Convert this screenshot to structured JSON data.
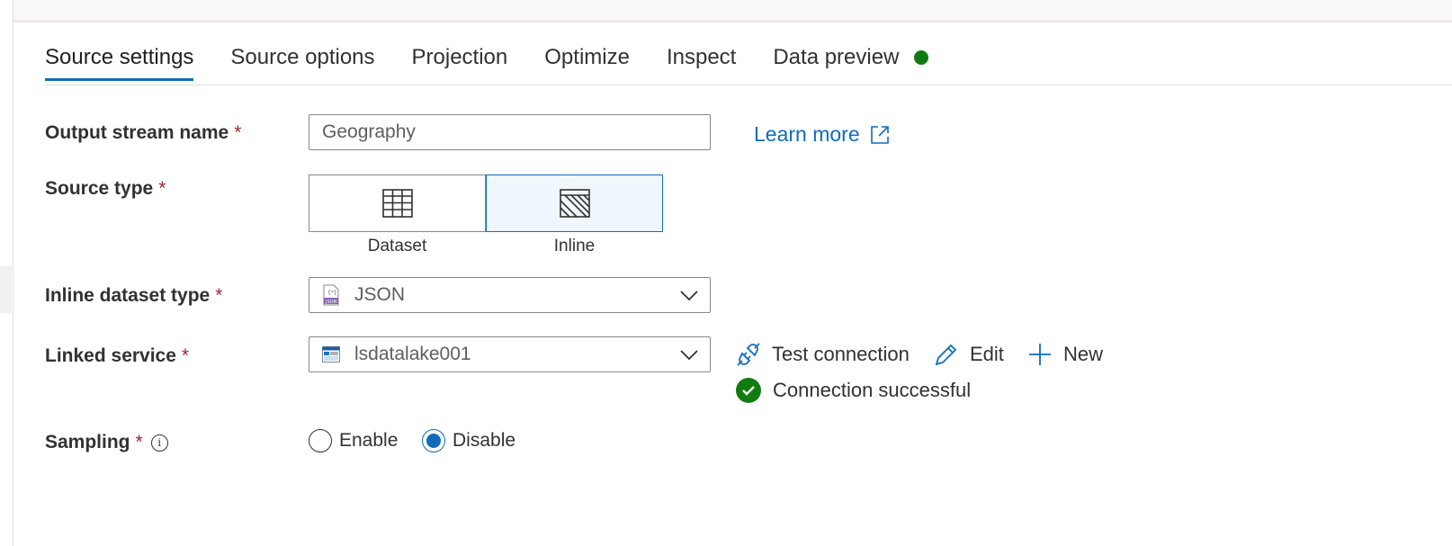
{
  "tabs": [
    {
      "label": "Source settings",
      "active": true
    },
    {
      "label": "Source options"
    },
    {
      "label": "Projection"
    },
    {
      "label": "Optimize"
    },
    {
      "label": "Inspect"
    },
    {
      "label": "Data preview",
      "status_color": "#107c10"
    }
  ],
  "form": {
    "required_marker": "*",
    "output_stream": {
      "label": "Output stream name",
      "value": "Geography",
      "learn_more": "Learn more"
    },
    "source_type": {
      "label": "Source type",
      "options": [
        {
          "label": "Dataset",
          "icon": "table-icon",
          "selected": false
        },
        {
          "label": "Inline",
          "icon": "inline-hatch-icon",
          "selected": true
        }
      ]
    },
    "inline_dataset_type": {
      "label": "Inline dataset type",
      "value": "JSON",
      "icon": "json-file-icon"
    },
    "linked_service": {
      "label": "Linked service",
      "value": "lsdatalake001",
      "icon": "storage-icon",
      "actions": {
        "test": "Test connection",
        "edit": "Edit",
        "new": "New"
      },
      "status": "Connection successful"
    },
    "sampling": {
      "label": "Sampling",
      "info_icon": "i",
      "options": [
        {
          "label": "Enable",
          "checked": false
        },
        {
          "label": "Disable",
          "checked": true
        }
      ]
    }
  },
  "colors": {
    "accent": "#0f6cbd",
    "success": "#107c10",
    "required": "#a4262c"
  }
}
